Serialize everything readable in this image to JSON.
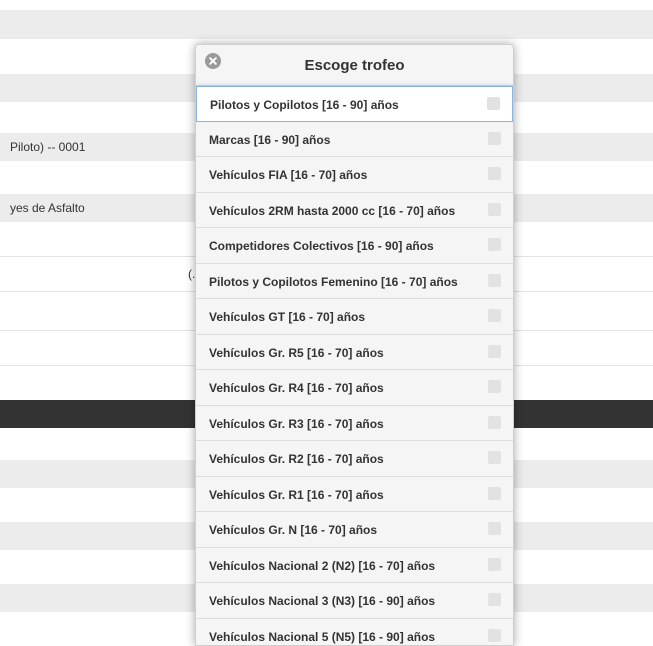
{
  "background": {
    "row_text_1": "Piloto) -- 0001",
    "row_text_2": "yes de Asfalto",
    "row_fragment": "(."
  },
  "popup": {
    "title": "Escoge trofeo",
    "close_icon": "close-circle-icon",
    "items": [
      {
        "label": "Pilotos y Copilotos [16 - 90] años",
        "active": true
      },
      {
        "label": "Marcas [16 - 90] años"
      },
      {
        "label": "Vehículos FIA [16 - 70] años"
      },
      {
        "label": "Vehículos 2RM hasta 2000 cc [16 - 70] años"
      },
      {
        "label": "Competidores Colectivos [16 - 90] años"
      },
      {
        "label": "Pilotos y Copilotos Femenino [16 - 70] años"
      },
      {
        "label": "Vehículos GT [16 - 70] años"
      },
      {
        "label": "Vehículos Gr. R5 [16 - 70] años"
      },
      {
        "label": "Vehículos Gr. R4 [16 - 70] años"
      },
      {
        "label": "Vehículos Gr. R3 [16 - 70] años"
      },
      {
        "label": "Vehículos Gr. R2 [16 - 70] años"
      },
      {
        "label": "Vehículos Gr. R1 [16 - 70] años"
      },
      {
        "label": "Vehículos Gr. N [16 - 70] años"
      },
      {
        "label": "Vehículos Nacional 2 (N2) [16 - 70] años"
      },
      {
        "label": "Vehículos Nacional 3 (N3) [16 - 90] años"
      },
      {
        "label": "Vehículos Nacional 5 (N5) [16 - 90] años"
      }
    ]
  }
}
